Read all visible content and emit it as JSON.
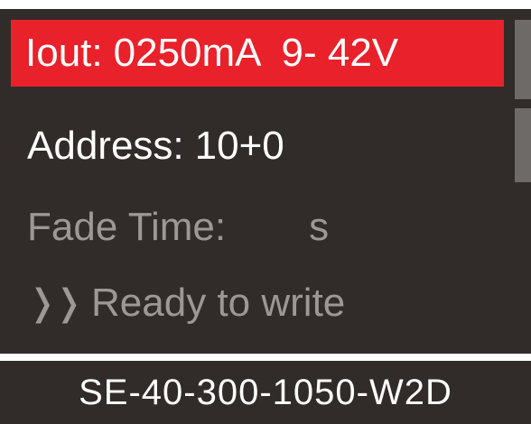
{
  "menu": {
    "current_row": {
      "label": "Iout:",
      "value": "0250mA",
      "range": "9- 42V"
    },
    "address": {
      "label": "Address:",
      "value": "10+0"
    },
    "fade": {
      "label": "Fade Time:",
      "unit": "s"
    },
    "status": {
      "icon": "double-chevron-right-icon",
      "text": "Ready to write"
    }
  },
  "device": {
    "model": "SE-40-300-1050-W2D"
  },
  "colors": {
    "background": "#312c2a",
    "highlight": "#e8212b",
    "dim_text": "#9b9896"
  }
}
